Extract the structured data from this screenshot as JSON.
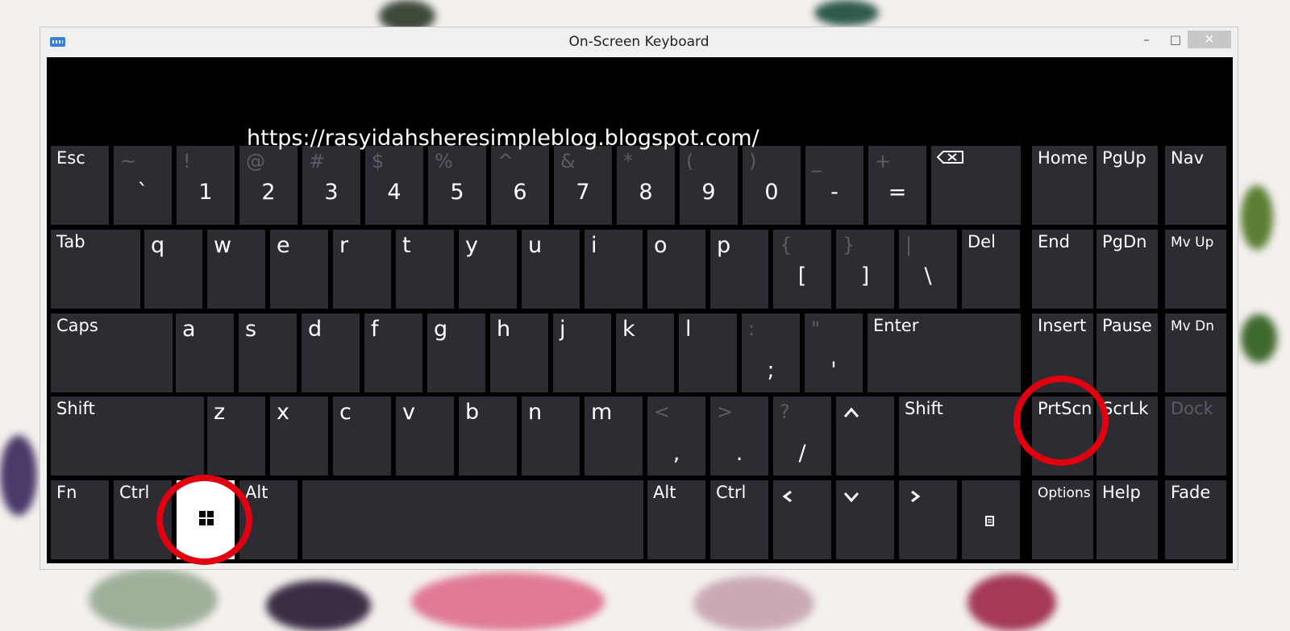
{
  "window": {
    "title": "On-Screen Keyboard",
    "minimize": "–",
    "maximize": "□",
    "close": "✕"
  },
  "overlay": {
    "url": "https://rasyidahsheresimpleblog.blogspot.com/"
  },
  "keys": {
    "row1": [
      {
        "name": "esc",
        "label": "Esc"
      },
      {
        "name": "backtick",
        "top": "~",
        "bottom": "`"
      },
      {
        "name": "1",
        "top": "!",
        "bottom": "1"
      },
      {
        "name": "2",
        "top": "@",
        "bottom": "2"
      },
      {
        "name": "3",
        "top": "#",
        "bottom": "3"
      },
      {
        "name": "4",
        "top": "$",
        "bottom": "4"
      },
      {
        "name": "5",
        "top": "%",
        "bottom": "5"
      },
      {
        "name": "6",
        "top": "^",
        "bottom": "6"
      },
      {
        "name": "7",
        "top": "&",
        "bottom": "7"
      },
      {
        "name": "8",
        "top": "*",
        "bottom": "8"
      },
      {
        "name": "9",
        "top": "(",
        "bottom": "9"
      },
      {
        "name": "0",
        "top": ")",
        "bottom": "0"
      },
      {
        "name": "minus",
        "top": "_",
        "bottom": "-"
      },
      {
        "name": "equals",
        "top": "+",
        "bottom": "="
      }
    ],
    "row2": [
      {
        "name": "tab",
        "label": "Tab"
      },
      {
        "name": "q",
        "label": "q"
      },
      {
        "name": "w",
        "label": "w"
      },
      {
        "name": "e",
        "label": "e"
      },
      {
        "name": "r",
        "label": "r"
      },
      {
        "name": "t",
        "label": "t"
      },
      {
        "name": "y",
        "label": "y"
      },
      {
        "name": "u",
        "label": "u"
      },
      {
        "name": "i",
        "label": "i"
      },
      {
        "name": "o",
        "label": "o"
      },
      {
        "name": "p",
        "label": "p"
      },
      {
        "name": "left-bracket",
        "top": "{",
        "bottom": "["
      },
      {
        "name": "right-bracket",
        "top": "}",
        "bottom": "]"
      },
      {
        "name": "backslash",
        "top": "|",
        "bottom": "\\"
      },
      {
        "name": "del",
        "label": "Del"
      }
    ],
    "row3": [
      {
        "name": "caps",
        "label": "Caps"
      },
      {
        "name": "a",
        "label": "a"
      },
      {
        "name": "s",
        "label": "s"
      },
      {
        "name": "d",
        "label": "d"
      },
      {
        "name": "f",
        "label": "f"
      },
      {
        "name": "g",
        "label": "g"
      },
      {
        "name": "h",
        "label": "h"
      },
      {
        "name": "j",
        "label": "j"
      },
      {
        "name": "k",
        "label": "k"
      },
      {
        "name": "l",
        "label": "l"
      },
      {
        "name": "semicolon",
        "top": ":",
        "bottom": ";"
      },
      {
        "name": "quote",
        "top": "\"",
        "bottom": "'"
      },
      {
        "name": "enter",
        "label": "Enter"
      }
    ],
    "row4": [
      {
        "name": "shift-left",
        "label": "Shift"
      },
      {
        "name": "z",
        "label": "z"
      },
      {
        "name": "x",
        "label": "x"
      },
      {
        "name": "c",
        "label": "c"
      },
      {
        "name": "v",
        "label": "v"
      },
      {
        "name": "b",
        "label": "b"
      },
      {
        "name": "n",
        "label": "n"
      },
      {
        "name": "m",
        "label": "m"
      },
      {
        "name": "comma",
        "top": "<",
        "bottom": ","
      },
      {
        "name": "period",
        "top": ">",
        "bottom": "."
      },
      {
        "name": "slash",
        "top": "?",
        "bottom": "/"
      },
      {
        "name": "up",
        "arrow": "^"
      },
      {
        "name": "shift-right",
        "label": "Shift"
      }
    ],
    "row5": [
      {
        "name": "fn",
        "label": "Fn"
      },
      {
        "name": "ctrl-left",
        "label": "Ctrl"
      },
      {
        "name": "alt-left",
        "label": "Alt"
      },
      {
        "name": "alt-right",
        "label": "Alt"
      },
      {
        "name": "ctrl-right",
        "label": "Ctrl"
      },
      {
        "name": "left",
        "arrow": "<"
      },
      {
        "name": "down",
        "arrow": "v"
      },
      {
        "name": "right",
        "arrow": ">"
      }
    ],
    "nav": [
      {
        "name": "home",
        "label": "Home"
      },
      {
        "name": "pgup",
        "label": "PgUp"
      },
      {
        "name": "nav",
        "label": "Nav"
      },
      {
        "name": "end",
        "label": "End"
      },
      {
        "name": "pgdn",
        "label": "PgDn"
      },
      {
        "name": "mvup",
        "label": "Mv Up"
      },
      {
        "name": "insert",
        "label": "Insert"
      },
      {
        "name": "pause",
        "label": "Pause"
      },
      {
        "name": "mvdn",
        "label": "Mv Dn"
      },
      {
        "name": "prtscn",
        "label": "PrtScn"
      },
      {
        "name": "scrlk",
        "label": "ScrLk"
      },
      {
        "name": "dock",
        "label": "Dock"
      },
      {
        "name": "options",
        "label": "Options"
      },
      {
        "name": "help",
        "label": "Help"
      },
      {
        "name": "fade",
        "label": "Fade"
      }
    ]
  },
  "colors": {
    "key": "#2d2c33",
    "board": "#000000",
    "dim_text": "#5d5c64",
    "highlight_circle": "#e0000f"
  }
}
